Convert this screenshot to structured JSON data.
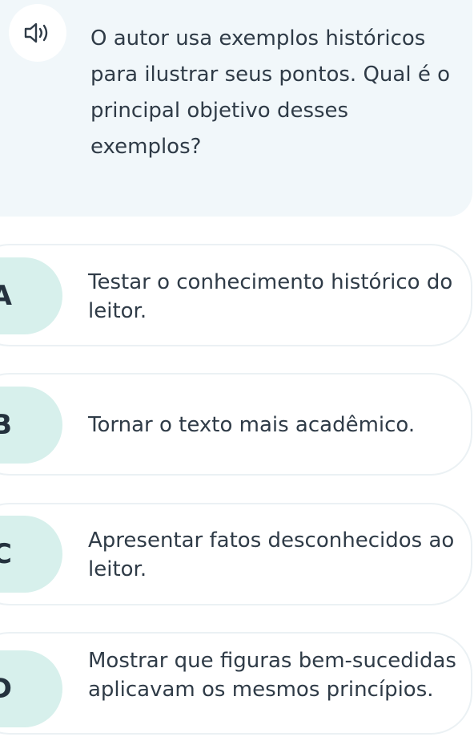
{
  "question": {
    "text": "O autor usa exemplos históricos para ilustrar seus pontos. Qual é o principal objetivo desses exemplos?",
    "audio_icon": "speaker-icon"
  },
  "options": [
    {
      "letter": "A",
      "text": "Testar o conhecimento histórico do leitor."
    },
    {
      "letter": "B",
      "text": "Tornar o texto mais acadêmico."
    },
    {
      "letter": "C",
      "text": "Apresentar fatos desconhecidos ao leitor."
    },
    {
      "letter": "D",
      "text": "Mostrar que figuras bem-sucedidas aplicavam os mesmos princípios."
    }
  ],
  "colors": {
    "question_bg": "#f1f7fa",
    "letter_bg": "#d7f0ec",
    "text": "#2f3b47",
    "option_border": "#ebf1f4"
  }
}
